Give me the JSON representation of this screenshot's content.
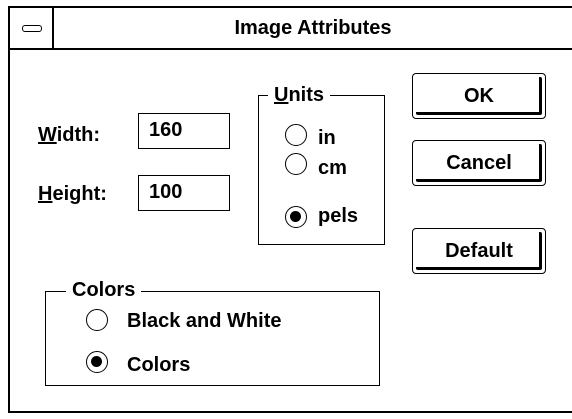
{
  "window": {
    "title": "Image Attributes"
  },
  "size": {
    "width_label": "Width:",
    "width_value": "160",
    "height_label": "Height:",
    "height_value": "100"
  },
  "units": {
    "legend": "Units",
    "options": [
      {
        "label": "in",
        "selected": false
      },
      {
        "label": "cm",
        "selected": false
      },
      {
        "label": "pels",
        "selected": true
      }
    ]
  },
  "colors": {
    "legend": "Colors",
    "options": [
      {
        "label": "Black and White",
        "selected": false
      },
      {
        "label": "Colors",
        "selected": true
      }
    ]
  },
  "buttons": {
    "ok": "OK",
    "cancel": "Cancel",
    "default": "Default"
  }
}
